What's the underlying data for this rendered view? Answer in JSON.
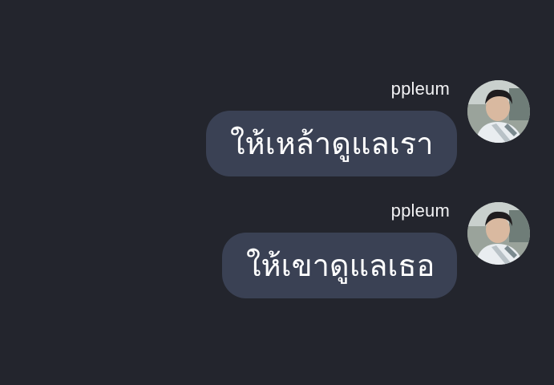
{
  "chat": {
    "messages": [
      {
        "sender": "ppleum",
        "text": "ให้เหล้าดูแลเรา",
        "avatar_icon": "user-avatar-photo"
      },
      {
        "sender": "ppleum",
        "text": "ให้เขาดูแลเธอ",
        "avatar_icon": "user-avatar-photo"
      }
    ]
  },
  "colors": {
    "background": "#23252d",
    "bubble": "#3a4154",
    "text": "#ffffff"
  }
}
